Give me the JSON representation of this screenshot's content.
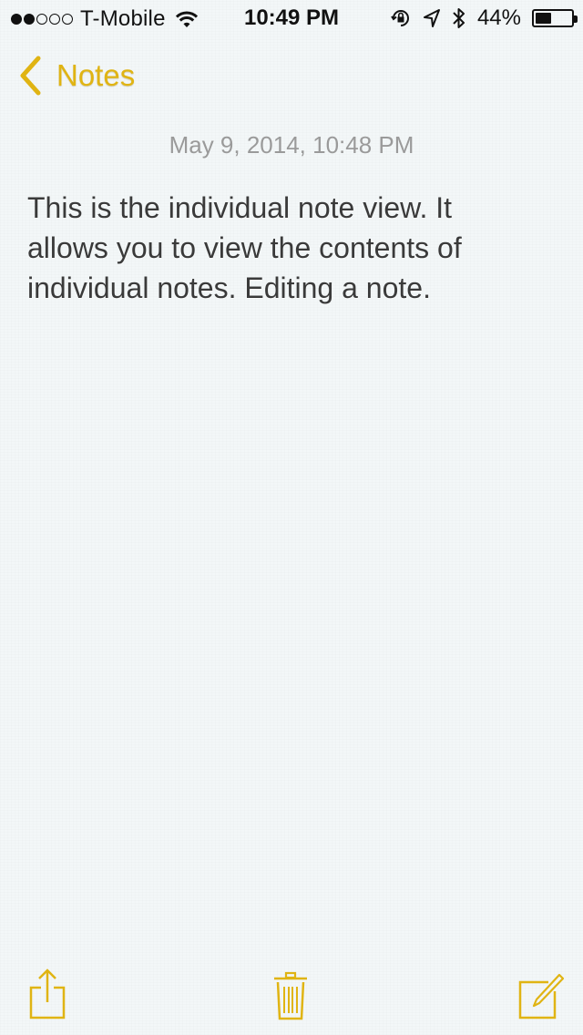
{
  "status_bar": {
    "carrier": "T-Mobile",
    "signal_bars_filled": 2,
    "signal_bars_total": 5,
    "time": "10:49 PM",
    "battery_percent": "44%",
    "battery_level": 0.44,
    "icons": [
      "wifi-icon",
      "orientation-lock-icon",
      "location-arrow-icon",
      "bluetooth-icon",
      "battery-icon"
    ]
  },
  "nav": {
    "back_label": "Notes",
    "accent_color": "#e0b413"
  },
  "note": {
    "date": "May 9, 2014, 10:48 PM",
    "body_lines": [
      "This is the individual note view. It",
      "allows you to view the contents of",
      "individual notes. Editing a note."
    ]
  },
  "toolbar": {
    "items": [
      "share-icon",
      "trash-icon",
      "compose-icon"
    ]
  }
}
